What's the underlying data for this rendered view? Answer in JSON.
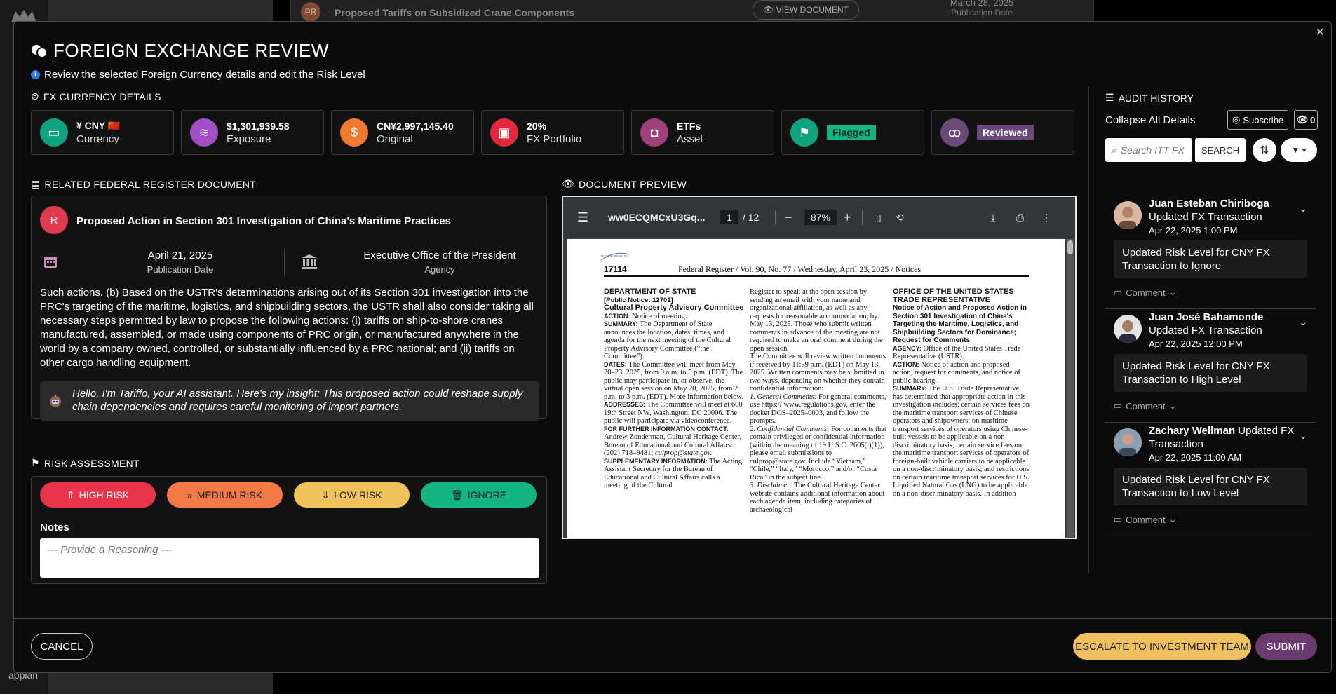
{
  "background": {
    "app_name": "appian",
    "card_avatar": "PR",
    "card_title": "Proposed Tariffs on Subsidized Crane Components",
    "view_document": "VIEW DOCUMENT",
    "card_date": "March 28, 2025",
    "card_date_label": "Publication Date"
  },
  "modal": {
    "title": "FOREIGN EXCHANGE REVIEW",
    "subtitle": "Review the selected Foreign Currency details and edit the Risk Level",
    "close": "×"
  },
  "fx": {
    "section_title": "FX CURRENCY DETAILS",
    "cards": [
      {
        "value": "¥ CNY 🇨🇳",
        "label": "Currency",
        "icon": "money-icon",
        "color": "#0fa37f"
      },
      {
        "value": "$1,301,939.58",
        "label": "Exposure",
        "icon": "coins-icon",
        "color": "#a24fc6"
      },
      {
        "value": "CN¥2,997,145.40",
        "label": "Original",
        "icon": "dollar-hand-icon",
        "color": "#f07a2f"
      },
      {
        "value": "20%",
        "label": "FX Portfolio",
        "icon": "briefcase-icon",
        "color": "#e0283f"
      },
      {
        "value": "ETFs",
        "label": "Asset",
        "icon": "box-icon",
        "color": "#a0407a"
      },
      {
        "value": "Flagged",
        "label": "",
        "icon": "flag-icon",
        "color": "#0fa37f"
      },
      {
        "value": "Reviewed",
        "label": "",
        "icon": "glasses-icon",
        "color": "#6b4a7a"
      }
    ]
  },
  "related": {
    "section_title": "RELATED FEDERAL REGISTER DOCUMENT",
    "avatar": "R",
    "title": "Proposed Action in Section 301 Investigation of China's Maritime Practices",
    "date": "April 21, 2025",
    "date_label": "Publication Date",
    "agency": "Executive Office of the President",
    "agency_label": "Agency",
    "body": "Such actions. (b) Based on the USTR's determinations arising out of its Section 301 investigation into the PRC's targeting of the maritime, logistics, and shipbuilding sectors, the USTR shall also consider taking all necessary steps permitted by law to propose the following actions: (i) tariffs on ship-to-shore cranes manufactured, assembled, or made using components of PRC origin, or manufactured anywhere in the world by a company owned, controlled, or substantially influenced by a PRC national; and (ii) tariffs on other cargo handling equipment.",
    "ai_insight": "Hello, I'm Tariffo, your AI assistant. Here's my insight: This proposed action could reshape supply chain dependencies and requires careful monitoring of import partners."
  },
  "risk": {
    "section_title": "RISK ASSESSMENT",
    "buttons": [
      {
        "label": "HIGH RISK",
        "icon": "double-chevron-up-icon",
        "color": "#e8344b",
        "text_color": "#ffffff"
      },
      {
        "label": "MEDIUM RISK",
        "icon": "double-chevron-right-icon",
        "color": "#f47a45",
        "text_color": "#222222"
      },
      {
        "label": "LOW RISK",
        "icon": "double-chevron-down-icon",
        "color": "#f2c25c",
        "text_color": "#222222"
      },
      {
        "label": "IGNORE",
        "icon": "trash-icon",
        "color": "#13b583",
        "text_color": "#222222"
      }
    ],
    "notes_label": "Notes",
    "notes_placeholder": "--- Provide a Reasoning ---"
  },
  "preview": {
    "section_title": "DOCUMENT PREVIEW",
    "file_name": "ww0ECQMCxU3Gq...",
    "page": "1",
    "total_pages": "/ 12",
    "zoom": "87%",
    "page_no": "17114",
    "running_head": "Federal Register / Vol. 90, No. 77 / Wednesday, April 23, 2025 / Notices",
    "col1_head": "DEPARTMENT OF STATE",
    "col1_notice": "[Public Notice: 12701]",
    "col1_title": "Cultural Property Advisory Committee",
    "col1_action_label": "ACTION:",
    "col1_action": "Notice of meeting.",
    "col1_summary_label": "SUMMARY:",
    "col1_summary": "The Department of State announces the location, dates, times, and agenda for the next meeting of the Cultural Property Advisory Committee (“the Committee”).",
    "col1_dates_label": "DATES:",
    "col1_dates": "The Committee will meet from May 20–23, 2025, from 9 a.m. to 5 p.m. (EDT). The public may participate in, or observe, the virtual open session on May 20, 2025, from 2 p.m. to 3 p.m. (EDT). More information below.",
    "col1_addr_label": "ADDRESSES:",
    "col1_addr": "The Committee will meet at 600 19th Street NW, Washington, DC 20006. The public will participate via videoconference.",
    "col1_contact_label": "FOR FURTHER INFORMATION CONTACT:",
    "col1_contact": "Andrew Zonderman, Cultural Heritage Center, Bureau of Educational and Cultural Affairs: (202) 718–9481;",
    "col1_email": "culprop@state.gov.",
    "col1_supp_label": "SUPPLEMENTARY INFORMATION:",
    "col1_supp": "The Acting Assistant Secretary for the Bureau of Educational and Cultural Affairs calls a meeting of the Cultural",
    "col2_text": "Register to speak at the open session by sending an email with your name and organizational affiliation, as well as any requests for reasonable accommodation, by May 13, 2025. Those who submit written comments in advance of the meeting are not required to make an oral comment during the open session.",
    "col2_text2": "The Committee will review written comments if received by 11:59 p.m. (EDT) on May 13, 2025. Written comments may be submitted in two ways, depending on whether they contain confidential information:",
    "col2_gc_label": "1. General Comments:",
    "col2_gc": "For general comments, use https:// www.regulations.gov, enter the docket DOS–2025–0003, and follow the prompts.",
    "col2_cc_label": "2. Confidential Comments:",
    "col2_cc": "For comments that contain privileged or confidential information (within the meaning of 19 U.S.C. 2605(i)(1)), please email submissions to culprop@state.gov. Include “Vietnam,” “Chile,” “Italy,” “Morocco,” and/or “Costa Rica” in the subject line.",
    "col2_disc_label": "3. Disclaimer:",
    "col2_disc": "The Cultural Heritage Center website contains additional information about each agenda item, including categories of archaeological",
    "col3_head": "OFFICE OF THE UNITED STATES TRADE REPRESENTATIVE",
    "col3_title": "Notice of Action and Proposed Action in Section 301 Investigation of China's Targeting the Maritime, Logistics, and Shipbuilding Sectors for Dominance; Request for Comments",
    "col3_agency_label": "AGENCY:",
    "col3_agency": "Office of the United States Trade Representative (USTR).",
    "col3_action_label": "ACTION:",
    "col3_action": "Notice of action and proposed action, request for comments, and notice of public hearing.",
    "col3_summary_label": "SUMMARY:",
    "col3_summary": "The U.S. Trade Representative has determined that appropriate action in this investigation includes: certain services fees on the maritime transport services of Chinese operators and shipowners; on maritime transport services of operators using Chinese-built vessels to be applicable on a non-discriminatory basis; certain service fees on the maritime transport services of operators of foreign-built vehicle carriers to be applicable on a non-discriminatory basis; and restrictions on certain maritime transport services for U.S. Liquified Natural Gas (LNG) to be applicable on a non-discriminatory basis. In addition"
  },
  "audit": {
    "section_title": "AUDIT HISTORY",
    "collapse": "Collapse All Details",
    "subscribe": "Subscribe",
    "watchers": "0",
    "search_placeholder": "Search ITT FX",
    "search_button": "SEARCH",
    "entries": [
      {
        "name": "Juan Esteban Chiriboga",
        "action": "Updated FX Transaction",
        "time": "Apr 22, 2025 1:00 PM",
        "message": "Updated Risk Level for CNY FX Transaction to Ignore",
        "comment": "Comment"
      },
      {
        "name": "Juan José Bahamonde",
        "action": "Updated FX Transaction",
        "time": "Apr 22, 2025 12:00 PM",
        "message": "Updated Risk Level for CNY FX Transaction to High Level",
        "comment": "Comment"
      },
      {
        "name": "Zachary Wellman",
        "action": "Updated FX Transaction",
        "time": "Apr 22, 2025 11:00 AM",
        "message": "Updated Risk Level for CNY FX Transaction to Low Level",
        "comment": "Comment"
      }
    ]
  },
  "footer": {
    "cancel": "CANCEL",
    "escalate": "ESCALATE TO INVESTMENT TEAM",
    "submit": "SUBMIT"
  }
}
